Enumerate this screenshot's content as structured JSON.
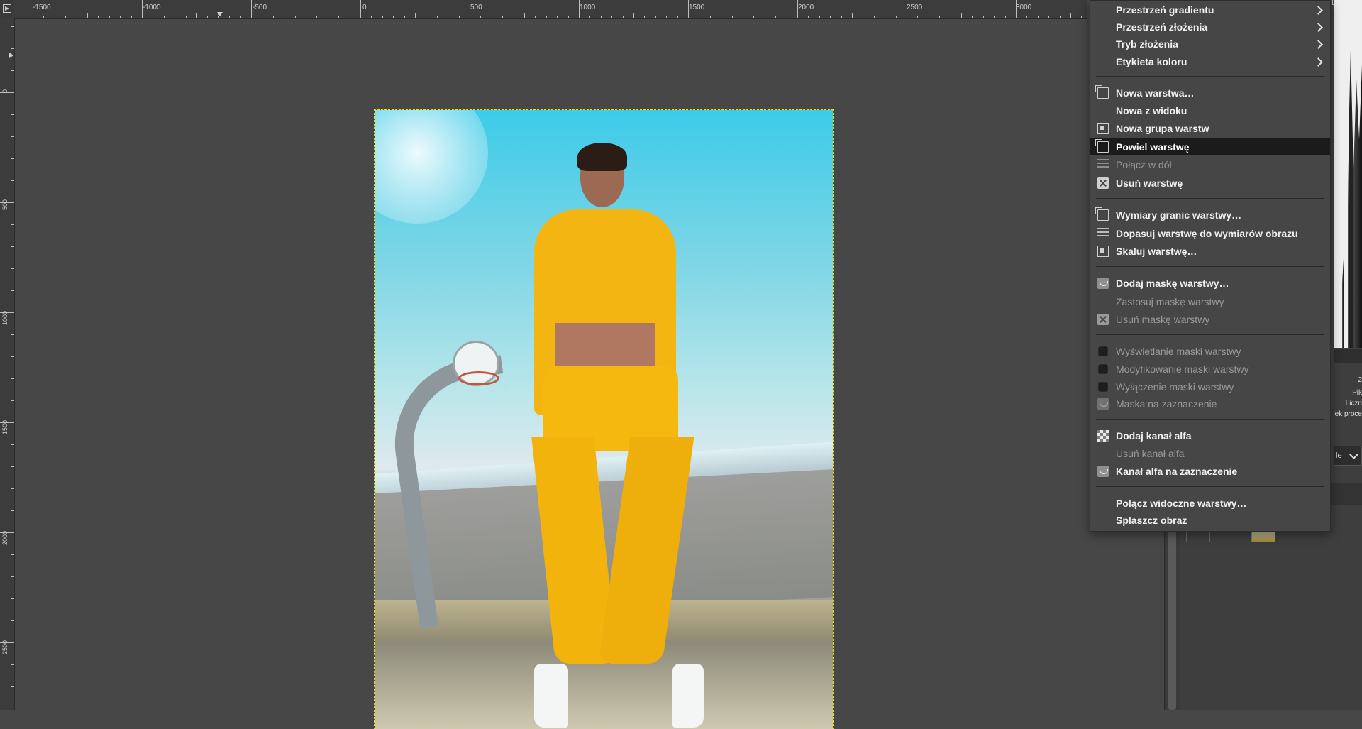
{
  "ruler": {
    "h_labels": [
      "-1500",
      "-1000",
      "-500",
      "0",
      "500",
      "1000",
      "1500",
      "2000",
      "2500",
      "3000"
    ],
    "v_labels": [
      "0",
      "500",
      "1000",
      "1500",
      "2000",
      "2500"
    ]
  },
  "context_menu": {
    "items": [
      {
        "label": "Przestrzeń gradientu",
        "submenu": true,
        "disabled": false
      },
      {
        "label": "Przestrzeń złożenia",
        "submenu": true,
        "disabled": false
      },
      {
        "label": "Tryb złożenia",
        "submenu": true,
        "disabled": false
      },
      {
        "label": "Etykieta koloru",
        "submenu": true,
        "disabled": false
      },
      {
        "label": "Nowa warstwa…",
        "icon": "new-layer-icon",
        "disabled": false
      },
      {
        "label": "Nowa z widoku",
        "disabled": false
      },
      {
        "label": "Nowa grupa warstw",
        "icon": "new-layer-group-icon",
        "disabled": false
      },
      {
        "label": "Powiel warstwę",
        "icon": "duplicate-layer-icon",
        "disabled": false,
        "highlighted": true
      },
      {
        "label": "Połącz w dół",
        "icon": "merge-down-icon",
        "disabled": true
      },
      {
        "label": "Usuń warstwę",
        "icon": "delete-icon",
        "disabled": false
      },
      {
        "label": "Wymiary granic warstwy…",
        "icon": "layer-boundary-icon",
        "disabled": false
      },
      {
        "label": "Dopasuj warstwę do wymiarów obrazu",
        "icon": "layer-to-image-size-icon",
        "disabled": false
      },
      {
        "label": "Skaluj warstwę…",
        "icon": "scale-layer-icon",
        "disabled": false
      },
      {
        "label": "Dodaj maskę warstwy…",
        "icon": "add-mask-icon",
        "disabled": false
      },
      {
        "label": "Zastosuj maskę warstwy",
        "disabled": true
      },
      {
        "label": "Usuń maskę warstwy",
        "icon": "delete-mask-icon",
        "disabled": true
      },
      {
        "label": "Wyświetlanie maski warstwy",
        "icon": "checkbox-icon",
        "disabled": true
      },
      {
        "label": "Modyfikowanie maski warstwy",
        "icon": "checkbox-icon",
        "disabled": true
      },
      {
        "label": "Wyłączenie maski warstwy",
        "icon": "checkbox-icon",
        "disabled": true
      },
      {
        "label": "Maska na zaznaczenie",
        "icon": "mask-to-selection-icon",
        "disabled": true
      },
      {
        "label": "Dodaj kanał alfa",
        "icon": "alpha-channel-icon",
        "disabled": false
      },
      {
        "label": "Usuń kanał alfa",
        "disabled": true
      },
      {
        "label": "Kanał alfa na zaznaczenie",
        "icon": "alpha-to-selection-icon",
        "disabled": false
      },
      {
        "label": "Połącz widoczne warstwy…",
        "disabled": false
      },
      {
        "label": "Spłaszcz obraz",
        "disabled": false
      }
    ]
  },
  "dock": {
    "info_1": "Pik",
    "info_2": "Liczn",
    "info_3": "lek proce",
    "value_top": "2",
    "dropdown": "le"
  },
  "colors": {
    "highlight": "#1b1b1b",
    "selection_outline": "#e9e300",
    "canvas_bg": "#474747"
  }
}
